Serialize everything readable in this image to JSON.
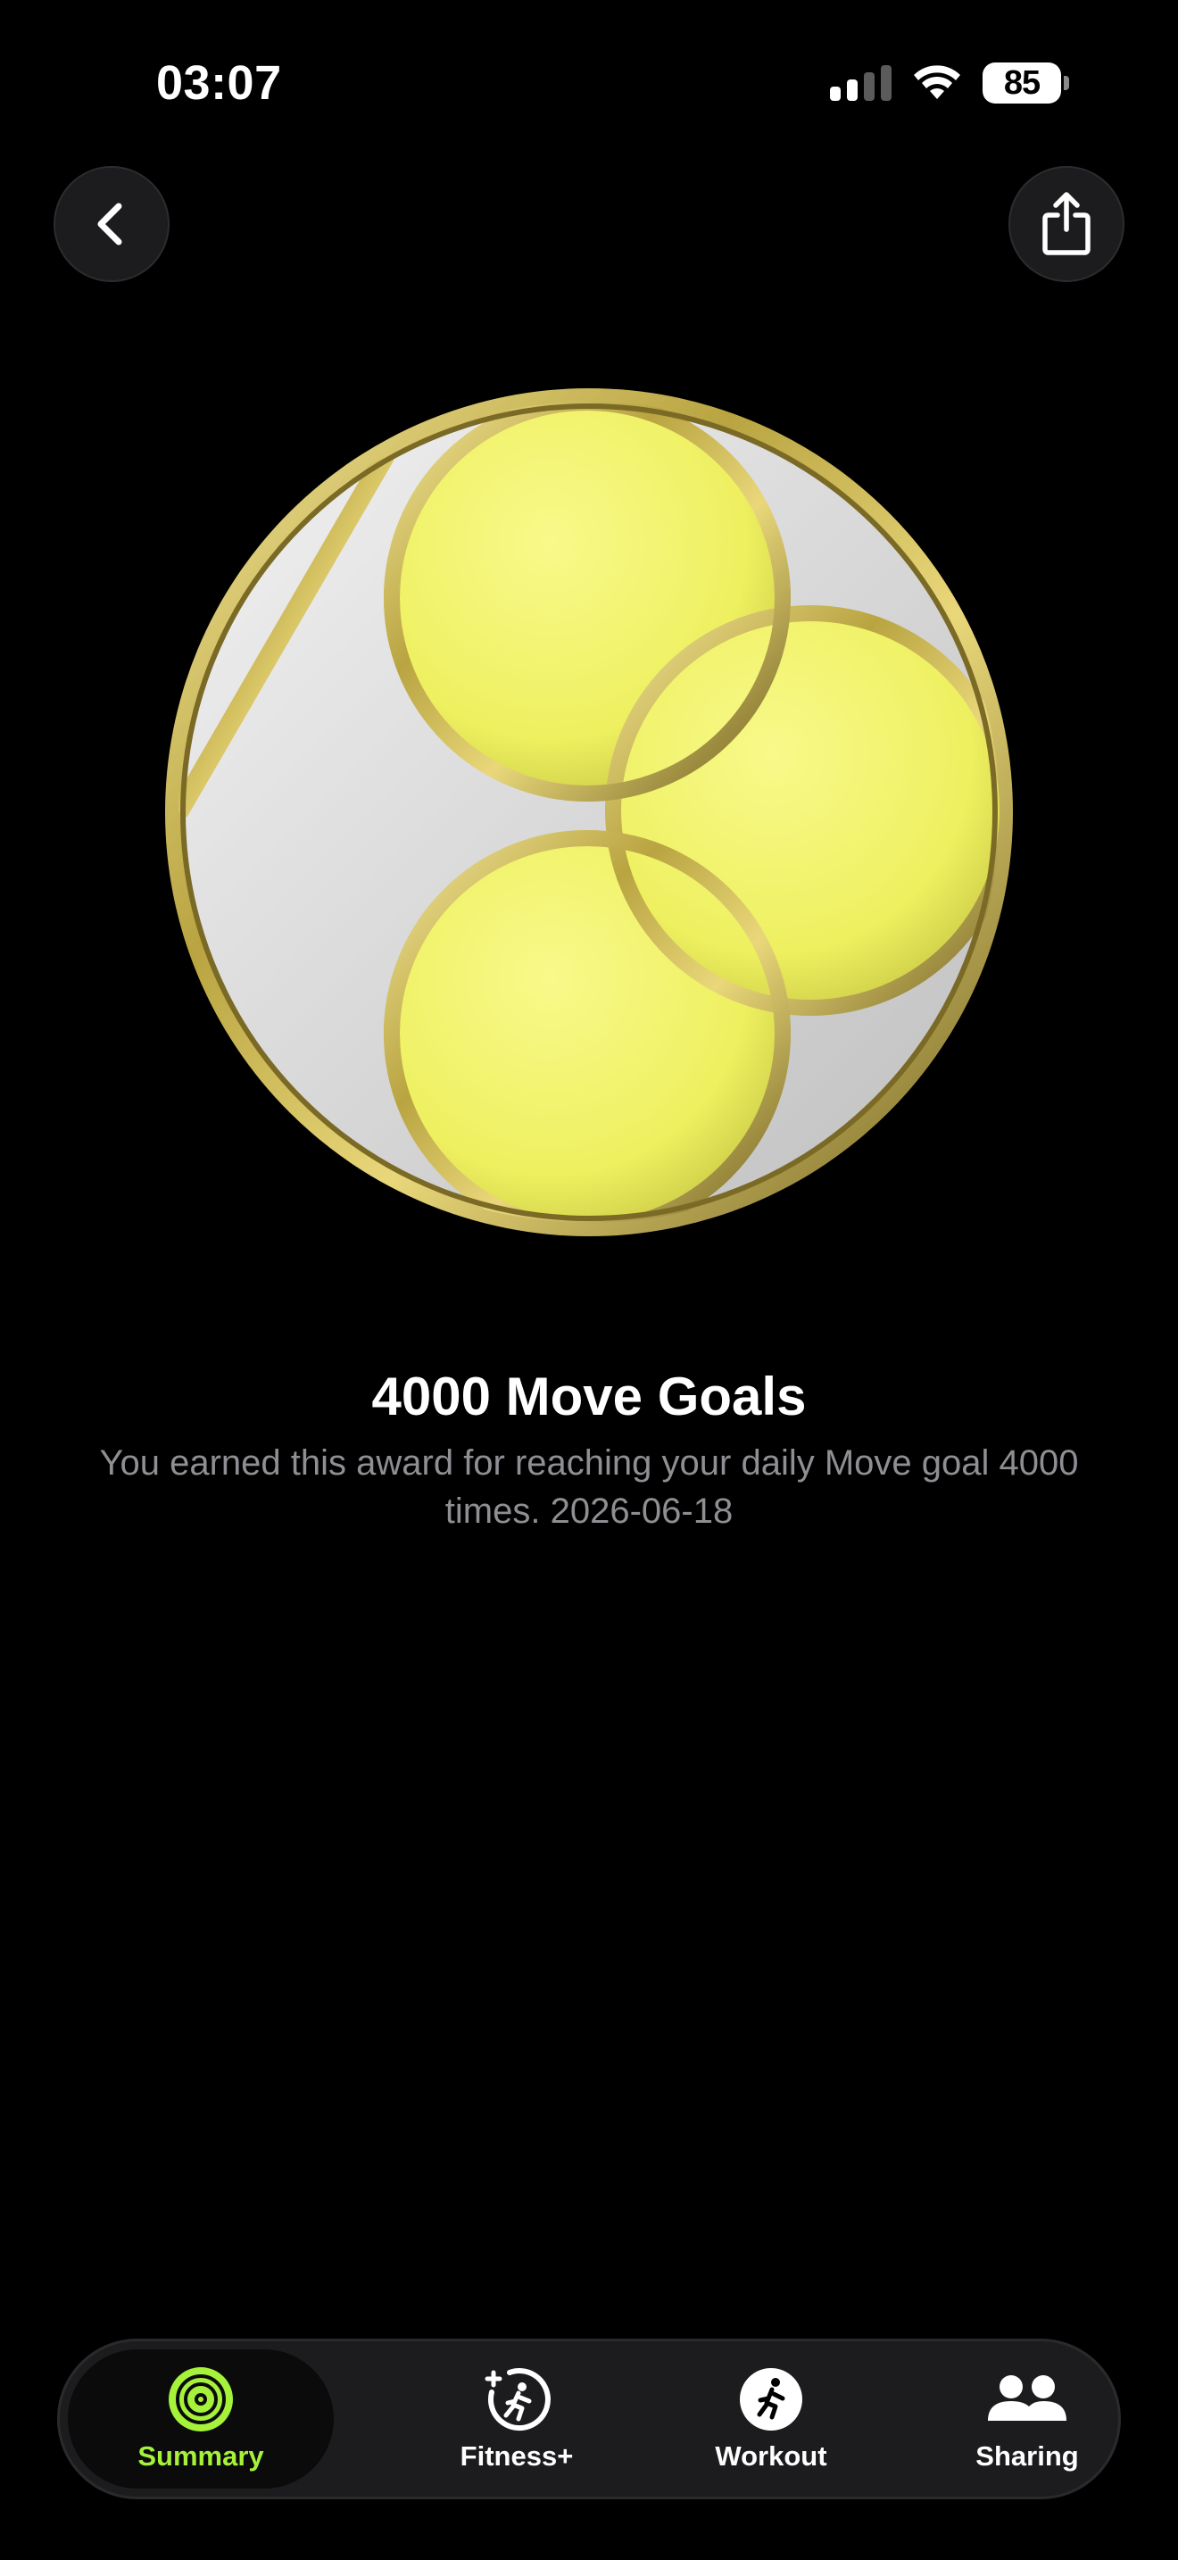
{
  "status_bar": {
    "time": "03:07",
    "battery": "85",
    "icons": [
      "cellular-signal-icon",
      "wifi-icon",
      "battery-icon"
    ]
  },
  "header": {
    "back_icon": "chevron-left-icon",
    "share_icon": "share-icon"
  },
  "award": {
    "title": "4000 Move Goals",
    "description": "You earned this award for reaching your daily Move goal 4000 times. 2026-06-18",
    "colors": {
      "gold": "#b8a53a",
      "yellow": "#eef060",
      "silver": "#d9d9d9"
    }
  },
  "tabbar": {
    "active": "Summary",
    "accent": "#a6f23a",
    "tabs": [
      {
        "label": "Summary",
        "icon": "activity-rings-icon"
      },
      {
        "label": "Fitness+",
        "icon": "fitness-plus-icon"
      },
      {
        "label": "Workout",
        "icon": "running-figure-icon"
      },
      {
        "label": "Sharing",
        "icon": "people-icon"
      }
    ]
  }
}
